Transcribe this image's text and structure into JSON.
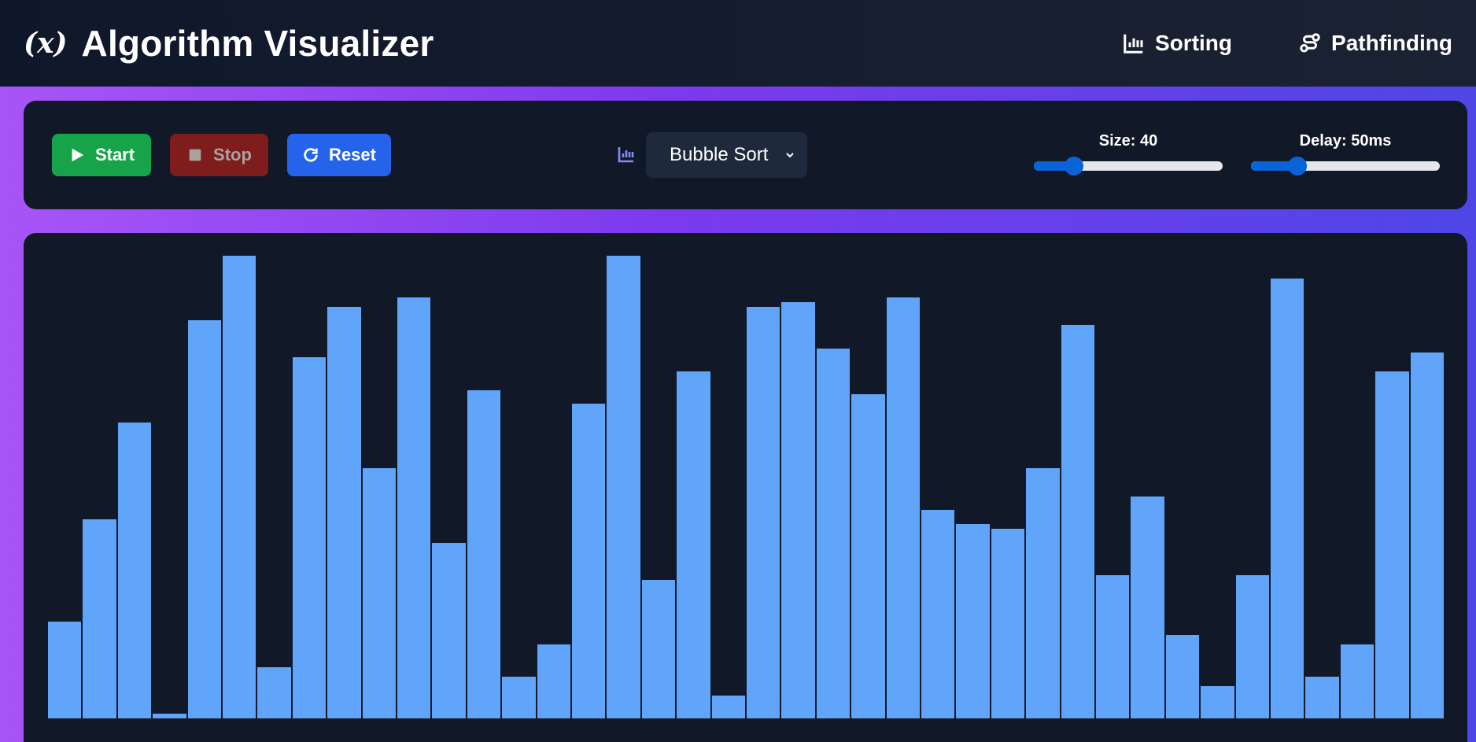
{
  "header": {
    "brand_icon": "(x)",
    "title": "Algorithm Visualizer",
    "nav": [
      {
        "label": "Sorting",
        "icon": "bar-chart-icon"
      },
      {
        "label": "Pathfinding",
        "icon": "route-icon"
      }
    ]
  },
  "controls": {
    "start_label": "Start",
    "stop_label": "Stop",
    "reset_label": "Reset",
    "algorithm": "Bubble Sort",
    "size": {
      "label": "Size: 40",
      "value": 40,
      "min": 10,
      "max": 150
    },
    "delay": {
      "label": "Delay: 50ms",
      "value": 50,
      "min": 1,
      "max": 200
    }
  },
  "colors": {
    "bar": "#60a5fa",
    "start": "#16a34a",
    "stop": "#7f1d1d",
    "reset": "#2563eb",
    "panel": "#111827"
  },
  "chart_data": {
    "type": "bar",
    "values": [
      21,
      43,
      64,
      1,
      86,
      100,
      11,
      78,
      89,
      54,
      91,
      38,
      71,
      9,
      16,
      68,
      100,
      30,
      75,
      5,
      89,
      90,
      80,
      70,
      91,
      45,
      42,
      41,
      54,
      85,
      31,
      48,
      18,
      7,
      31,
      95,
      9,
      16,
      75,
      79
    ],
    "ylim": [
      0,
      100
    ]
  }
}
